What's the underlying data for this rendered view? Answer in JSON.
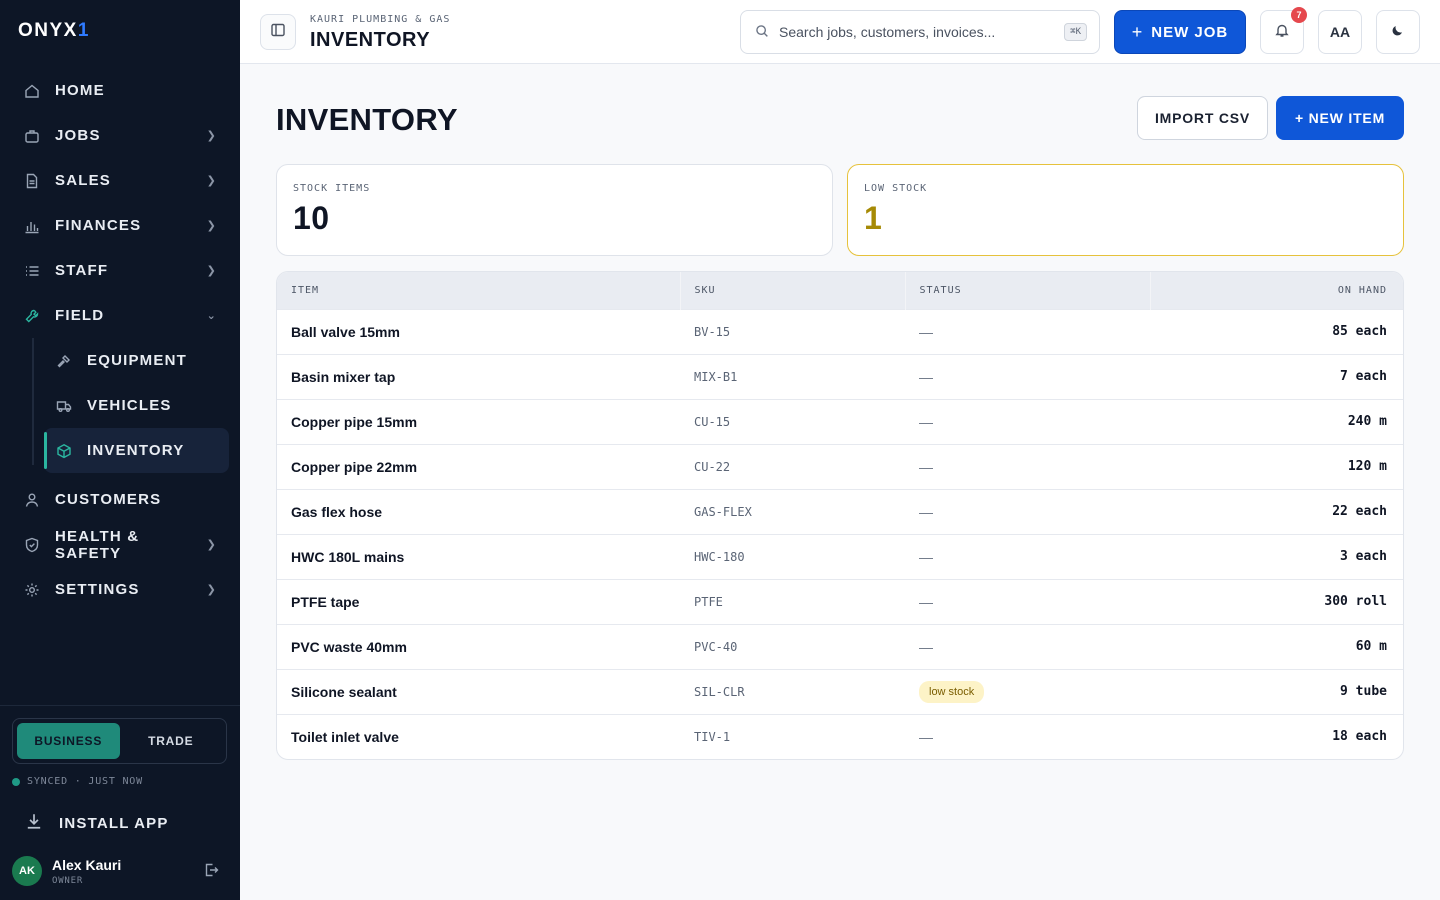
{
  "app": {
    "logo_text": "ONYX",
    "logo_accent": "1"
  },
  "sidebar": {
    "items": [
      {
        "label": "HOME",
        "icon": "home-icon"
      },
      {
        "label": "JOBS",
        "icon": "briefcase-icon"
      },
      {
        "label": "SALES",
        "icon": "document-icon"
      },
      {
        "label": "FINANCES",
        "icon": "bar-chart-icon"
      },
      {
        "label": "STAFF",
        "icon": "list-icon"
      },
      {
        "label": "FIELD",
        "icon": "wrench-icon"
      }
    ],
    "field_subitems": [
      {
        "label": "EQUIPMENT",
        "icon": "hammer-icon"
      },
      {
        "label": "VEHICLES",
        "icon": "truck-icon"
      },
      {
        "label": "INVENTORY",
        "icon": "box-icon"
      }
    ],
    "items_after": [
      {
        "label": "CUSTOMERS",
        "icon": "user-icon"
      },
      {
        "label": "HEALTH & SAFETY",
        "icon": "shield-icon"
      },
      {
        "label": "SETTINGS",
        "icon": "gear-icon"
      }
    ],
    "mode": {
      "business": "BUSINESS",
      "trade": "TRADE",
      "active": "BUSINESS"
    },
    "sync_status": "SYNCED · JUST NOW",
    "install_label": "INSTALL APP",
    "user": {
      "initials": "AK",
      "name": "Alex Kauri",
      "role": "OWNER"
    }
  },
  "topbar": {
    "company": "KAURI PLUMBING & GAS",
    "title": "INVENTORY",
    "search_placeholder": "Search jobs, customers, invoices...",
    "search_shortcut": "⌘K",
    "new_job_label": "NEW JOB",
    "notifications_count": "7",
    "font_toggle_label": "AA"
  },
  "main": {
    "title": "INVENTORY",
    "import_label": "IMPORT CSV",
    "new_item_label": "+ NEW ITEM",
    "stats": {
      "stock_items_label": "STOCK ITEMS",
      "stock_items_value": "10",
      "low_stock_label": "LOW STOCK",
      "low_stock_value": "1"
    },
    "table": {
      "headers": {
        "item": "ITEM",
        "sku": "SKU",
        "status": "STATUS",
        "on_hand": "ON HAND"
      },
      "rows": [
        {
          "item": "Ball valve 15mm",
          "sku": "BV-15",
          "status": "—",
          "on_hand": "85 each"
        },
        {
          "item": "Basin mixer tap",
          "sku": "MIX-B1",
          "status": "—",
          "on_hand": "7 each"
        },
        {
          "item": "Copper pipe 15mm",
          "sku": "CU-15",
          "status": "—",
          "on_hand": "240 m"
        },
        {
          "item": "Copper pipe 22mm",
          "sku": "CU-22",
          "status": "—",
          "on_hand": "120 m"
        },
        {
          "item": "Gas flex hose",
          "sku": "GAS-FLEX",
          "status": "—",
          "on_hand": "22 each"
        },
        {
          "item": "HWC 180L mains",
          "sku": "HWC-180",
          "status": "—",
          "on_hand": "3 each"
        },
        {
          "item": "PTFE tape",
          "sku": "PTFE",
          "status": "—",
          "on_hand": "300 roll"
        },
        {
          "item": "PVC waste 40mm",
          "sku": "PVC-40",
          "status": "—",
          "on_hand": "60 m"
        },
        {
          "item": "Silicone sealant",
          "sku": "SIL-CLR",
          "status": "low stock",
          "on_hand": "9 tube"
        },
        {
          "item": "Toilet inlet valve",
          "sku": "TIV-1",
          "status": "—",
          "on_hand": "18 each"
        }
      ]
    }
  },
  "colors": {
    "sidebar_bg": "#0d1626",
    "accent_teal": "#2bb6a0",
    "primary_blue": "#0f57d8",
    "low_stock_amber": "#a68a05",
    "badge_red": "#e5484d"
  }
}
